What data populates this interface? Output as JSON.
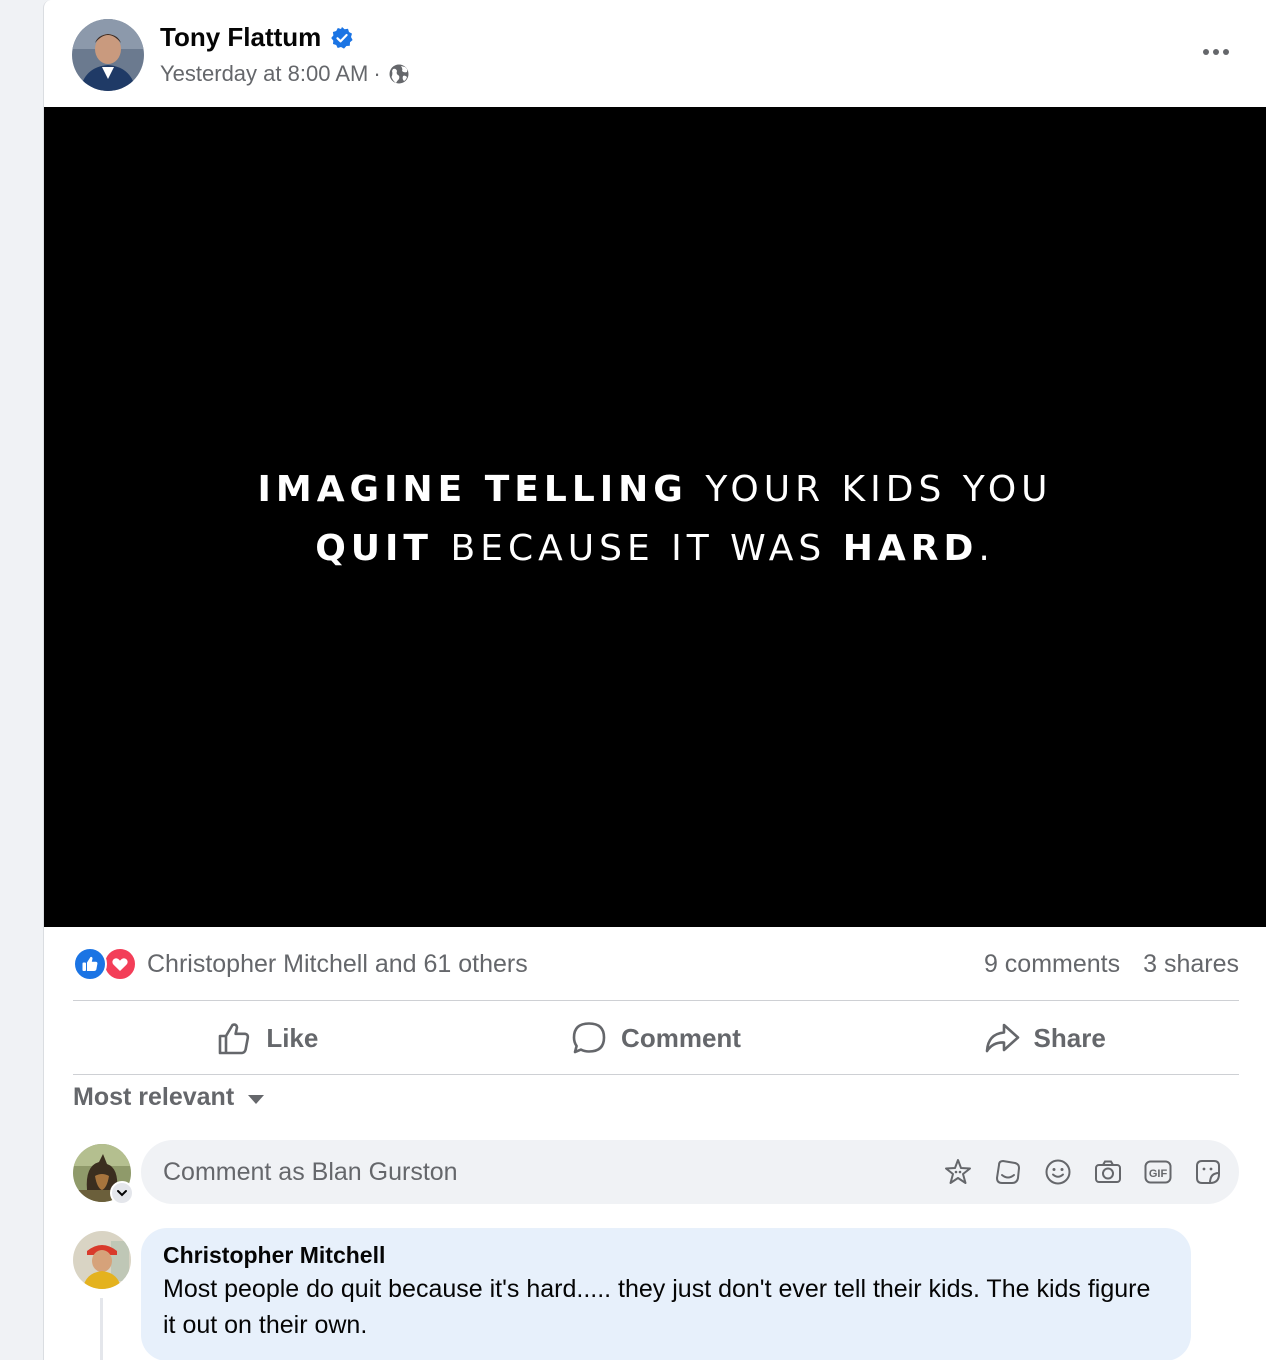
{
  "post": {
    "author": "Tony Flattum",
    "verified": true,
    "timestamp": "Yesterday at 8:00 AM",
    "separator": "·",
    "audience_icon": "globe-icon",
    "more_icon": "more-options-icon",
    "media": {
      "line1": [
        {
          "text": "IMAGINE ",
          "bold": true
        },
        {
          "text": "TELLING ",
          "bold": true
        },
        {
          "text": "YOUR KIDS YOU",
          "bold": false
        }
      ],
      "line2": [
        {
          "text": "QUIT ",
          "bold": true
        },
        {
          "text": "BECAUSE IT WAS ",
          "bold": false
        },
        {
          "text": "HARD",
          "bold": true
        },
        {
          "text": ".",
          "bold": false
        }
      ]
    },
    "reactions": {
      "icons": [
        "like-reaction-icon",
        "love-reaction-icon"
      ],
      "summary": "Christopher Mitchell and 61 others"
    },
    "comments_count": "9 comments",
    "shares_count": "3 shares",
    "actions": {
      "like": "Like",
      "comment": "Comment",
      "share": "Share"
    }
  },
  "comments_section": {
    "sort_label": "Most relevant",
    "composer": {
      "placeholder": "Comment as Blan Gurston",
      "tools": [
        "avatar-sticker-icon",
        "sticker-pack-icon",
        "emoji-icon",
        "camera-icon",
        "gif-icon",
        "sticker-icon"
      ]
    },
    "comments": [
      {
        "author": "Christopher Mitchell",
        "text": "Most people do quit because it's hard..... they just don't ever tell their kids. The kids figure it out on their own."
      }
    ]
  },
  "colors": {
    "brand_blue": "#1b74e4",
    "love_red": "#f33e58",
    "secondary_text": "#65676b",
    "comment_bubble": "#e7f0fb"
  }
}
